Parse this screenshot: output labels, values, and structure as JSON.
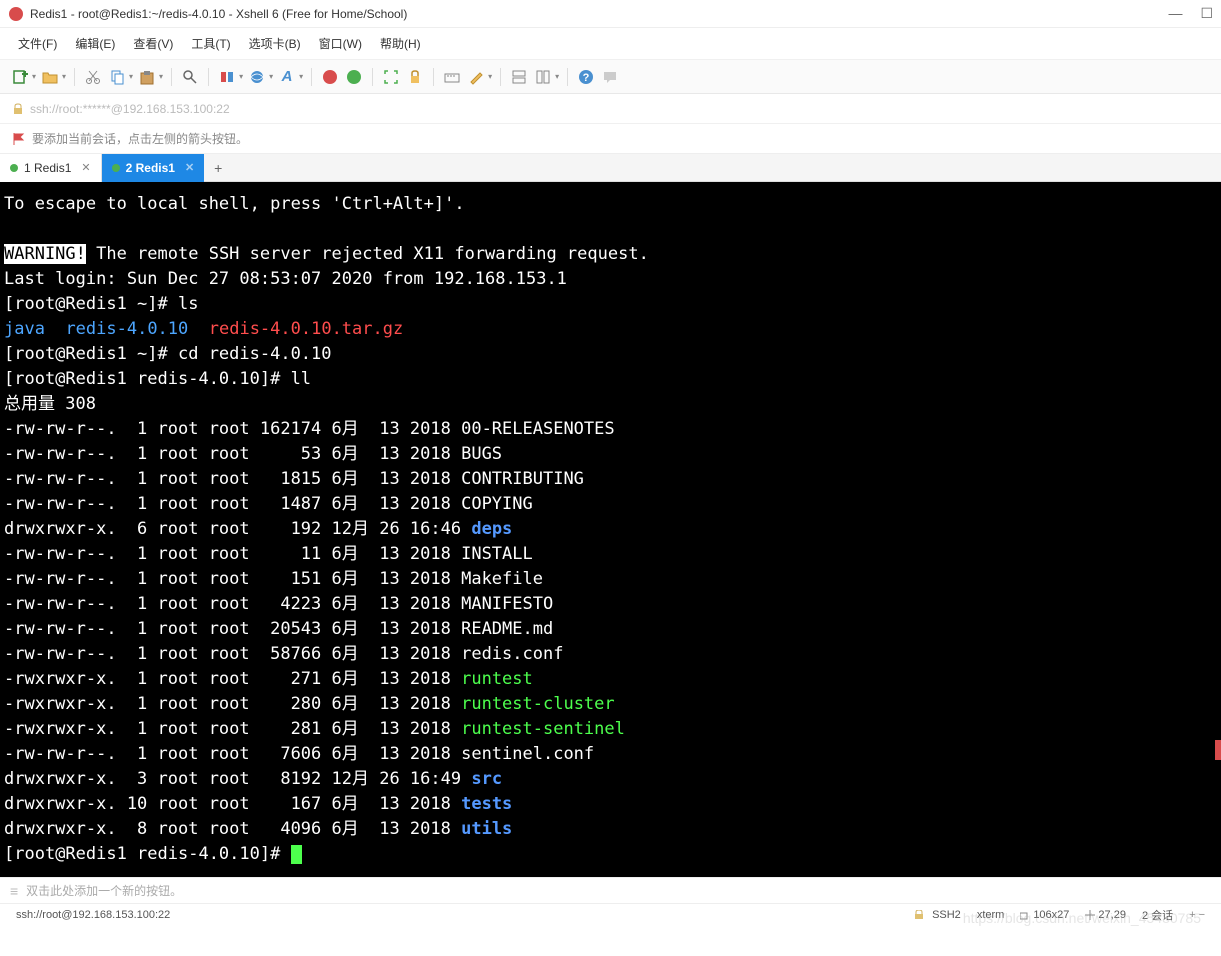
{
  "titlebar": {
    "title": "Redis1 - root@Redis1:~/redis-4.0.10 - Xshell 6 (Free for Home/School)"
  },
  "menu": {
    "file": "文件(F)",
    "edit": "编辑(E)",
    "view": "查看(V)",
    "tools": "工具(T)",
    "tabs": "选项卡(B)",
    "window": "窗口(W)",
    "help": "帮助(H)"
  },
  "address": {
    "url": "ssh://root:******@192.168.153.100:22"
  },
  "helpbar": {
    "text": "要添加当前会话，点击左侧的箭头按钮。"
  },
  "tabs": {
    "t1": "1 Redis1",
    "t2": "2 Redis1"
  },
  "bottombar": {
    "hint": "双击此处添加一个新的按钮。"
  },
  "status": {
    "conn": "ssh://root@192.168.153.100:22",
    "proto": "SSH2",
    "term": "xterm",
    "size": "106x27",
    "pos": "27,29",
    "sessions": "2 会话"
  },
  "watermark": "https://blog.csdn.net/weixin_45480785",
  "term": {
    "escape": "To escape to local shell, press 'Ctrl+Alt+]'.",
    "warn_label": "WARNING!",
    "warn_rest": " The remote SSH server rejected X11 forwarding request.",
    "lastlogin": "Last login: Sun Dec 27 08:53:07 2020 from 192.168.153.1",
    "p1": "[root@Redis1 ~]# ls",
    "ls_java": "java",
    "ls_dir": "redis-4.0.10",
    "ls_tar": "redis-4.0.10.tar.gz",
    "p2": "[root@Redis1 ~]# cd redis-4.0.10",
    "p3": "[root@Redis1 redis-4.0.10]# ll",
    "total": "总用量 308",
    "rows": [
      {
        "pre": "-rw-rw-r--.  1 root root 162174 6月  13 2018 ",
        "name": "00-RELEASENOTES",
        "cls": ""
      },
      {
        "pre": "-rw-rw-r--.  1 root root     53 6月  13 2018 ",
        "name": "BUGS",
        "cls": ""
      },
      {
        "pre": "-rw-rw-r--.  1 root root   1815 6月  13 2018 ",
        "name": "CONTRIBUTING",
        "cls": ""
      },
      {
        "pre": "-rw-rw-r--.  1 root root   1487 6月  13 2018 ",
        "name": "COPYING",
        "cls": ""
      },
      {
        "pre": "drwxrwxr-x.  6 root root    192 12月 26 16:46 ",
        "name": "deps",
        "cls": "t-bblue"
      },
      {
        "pre": "-rw-rw-r--.  1 root root     11 6月  13 2018 ",
        "name": "INSTALL",
        "cls": ""
      },
      {
        "pre": "-rw-rw-r--.  1 root root    151 6月  13 2018 ",
        "name": "Makefile",
        "cls": ""
      },
      {
        "pre": "-rw-rw-r--.  1 root root   4223 6月  13 2018 ",
        "name": "MANIFESTO",
        "cls": ""
      },
      {
        "pre": "-rw-rw-r--.  1 root root  20543 6月  13 2018 ",
        "name": "README.md",
        "cls": ""
      },
      {
        "pre": "-rw-rw-r--.  1 root root  58766 6月  13 2018 ",
        "name": "redis.conf",
        "cls": ""
      },
      {
        "pre": "-rwxrwxr-x.  1 root root    271 6月  13 2018 ",
        "name": "runtest",
        "cls": "t-green"
      },
      {
        "pre": "-rwxrwxr-x.  1 root root    280 6月  13 2018 ",
        "name": "runtest-cluster",
        "cls": "t-green"
      },
      {
        "pre": "-rwxrwxr-x.  1 root root    281 6月  13 2018 ",
        "name": "runtest-sentinel",
        "cls": "t-green"
      },
      {
        "pre": "-rw-rw-r--.  1 root root   7606 6月  13 2018 ",
        "name": "sentinel.conf",
        "cls": ""
      },
      {
        "pre": "drwxrwxr-x.  3 root root   8192 12月 26 16:49 ",
        "name": "src",
        "cls": "t-bblue"
      },
      {
        "pre": "drwxrwxr-x. 10 root root    167 6月  13 2018 ",
        "name": "tests",
        "cls": "t-bblue"
      },
      {
        "pre": "drwxrwxr-x.  8 root root   4096 6月  13 2018 ",
        "name": "utils",
        "cls": "t-bblue"
      }
    ],
    "p4": "[root@Redis1 redis-4.0.10]# "
  }
}
